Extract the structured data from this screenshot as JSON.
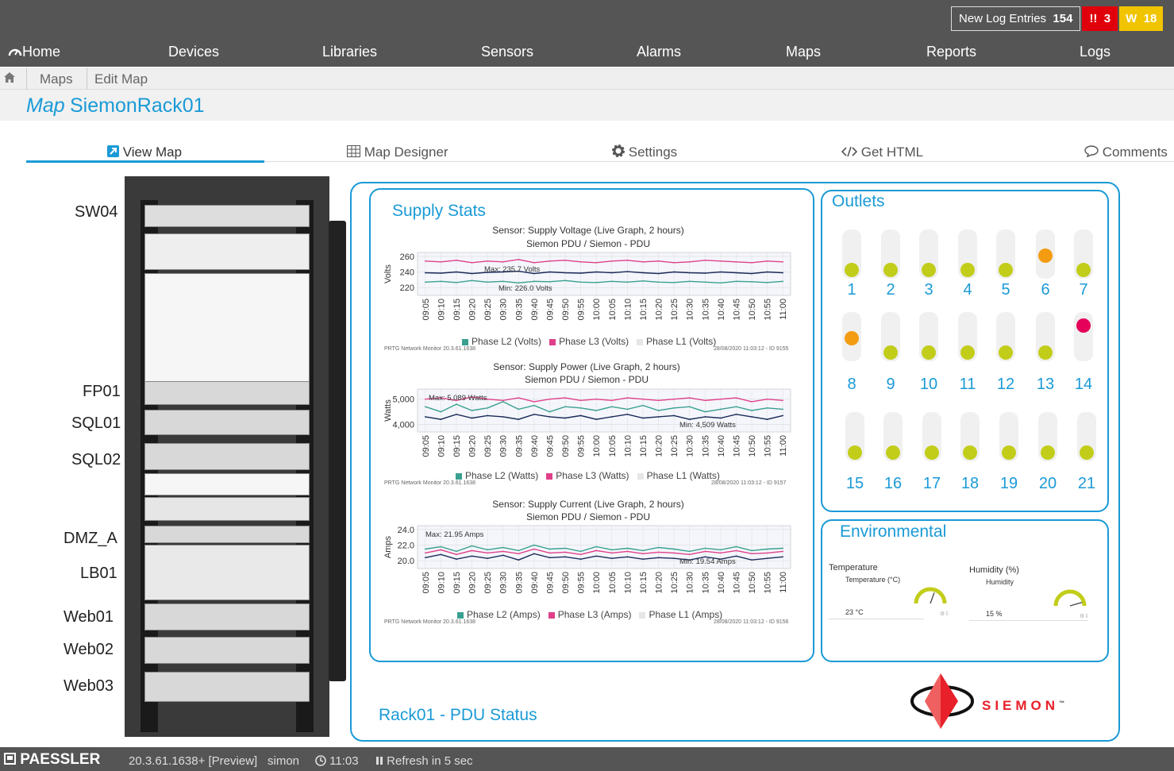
{
  "topbar": {
    "log_label": "New Log Entries",
    "log_count": "154",
    "errors": "3",
    "warnings": "18",
    "errors_icon": "!!",
    "warnings_icon": "W"
  },
  "nav": [
    "Home",
    "Devices",
    "Libraries",
    "Sensors",
    "Alarms",
    "Maps",
    "Reports",
    "Logs"
  ],
  "breadcrumb": [
    "Maps",
    "Edit Map"
  ],
  "title": {
    "prefix": "Map",
    "name": "SiemonRack01"
  },
  "tabs": [
    "View Map",
    "Map Designer",
    "Settings",
    "Get HTML",
    "Comments"
  ],
  "rack": {
    "labels": [
      "SW04",
      "FP01",
      "SQL01",
      "SQL02",
      "DMZ_A",
      "LB01",
      "Web01",
      "Web02",
      "Web03"
    ]
  },
  "supply": {
    "title": "Supply Stats",
    "footer_title": "Rack01 - PDU Status",
    "footer_left": "PRTG Network Monitor 20.3.61.1638"
  },
  "chart_data": [
    {
      "type": "line",
      "title": "Sensor: Supply Voltage (Live Graph, 2 hours)",
      "subtitle": "Siemon PDU / Siemon - PDU",
      "ylabel": "Volts",
      "ylim": [
        210,
        265
      ],
      "yticks": [
        "260",
        "240",
        "220"
      ],
      "ytick_values": [
        260,
        240,
        220
      ],
      "x": [
        "09:05",
        "09:10",
        "09:15",
        "09:20",
        "09:25",
        "09:30",
        "09:35",
        "09:40",
        "09:45",
        "09:50",
        "09:55",
        "10:00",
        "10:05",
        "10:10",
        "10:15",
        "10:20",
        "10:25",
        "10:30",
        "10:35",
        "10:40",
        "10:45",
        "10:50",
        "10:55",
        "11:00"
      ],
      "series": [
        {
          "name": "Phase L2  (Volts)",
          "color": "#1a2a5a",
          "values": [
            239,
            238.5,
            240,
            238,
            239.5,
            240,
            241,
            238,
            240,
            239,
            238.5,
            240,
            239,
            240.5,
            239,
            238,
            240,
            239,
            238.5,
            240,
            239,
            238,
            240,
            239
          ]
        },
        {
          "name": "Phase L3  (Volts)",
          "color": "#e0408a",
          "values": [
            254,
            253,
            255,
            252,
            254,
            253,
            256,
            252,
            254,
            255,
            253,
            252,
            254,
            255,
            253,
            254,
            252,
            253,
            255,
            254,
            253,
            252,
            254,
            253
          ]
        },
        {
          "name": "Phase L1  (Volts)",
          "color": "#3aa090",
          "values": [
            227,
            228,
            226.5,
            229,
            227,
            228,
            226,
            228,
            227.5,
            229,
            227,
            226.5,
            228,
            227,
            228.5,
            227,
            226.5,
            228,
            227,
            226,
            228,
            227.5,
            226.5,
            228
          ]
        }
      ],
      "annotations": [
        "Max: 235.7 Volts",
        "Min: 226.0 Volts"
      ],
      "footer_right": "28/08/2020 11:03:12 - ID 9155"
    },
    {
      "type": "line",
      "title": "Sensor: Supply Power (Live Graph, 2 hours)",
      "subtitle": "Siemon PDU / Siemon - PDU",
      "ylabel": "Watts",
      "ylim": [
        3700,
        5400
      ],
      "yticks": [
        "5,000",
        "4,000"
      ],
      "ytick_values": [
        5000,
        4000
      ],
      "x": [
        "09:05",
        "09:10",
        "09:15",
        "09:20",
        "09:25",
        "09:30",
        "09:35",
        "09:40",
        "09:45",
        "09:50",
        "09:55",
        "10:00",
        "10:05",
        "10:10",
        "10:15",
        "10:20",
        "10:25",
        "10:30",
        "10:35",
        "10:40",
        "10:45",
        "10:50",
        "10:55",
        "11:00"
      ],
      "series": [
        {
          "name": "Phase L2  (Watts)",
          "color": "#3aa090",
          "values": [
            4700,
            4500,
            4800,
            4550,
            4650,
            4900,
            4600,
            4750,
            4500,
            4700,
            4650,
            4550,
            4700,
            4600,
            4750,
            4550,
            4650,
            4700,
            4500,
            4600,
            4700,
            4550,
            4650,
            4600
          ]
        },
        {
          "name": "Phase L3  (Watts)",
          "color": "#e0408a",
          "values": [
            5000,
            5050,
            4950,
            5089,
            5000,
            4950,
            5050,
            4900,
            5000,
            5050,
            4950,
            5000,
            4950,
            5050,
            5000,
            4950,
            5000,
            5050,
            4950,
            5000,
            5050,
            4900,
            5000,
            4950
          ]
        },
        {
          "name": "Phase L1  (Watts)",
          "color": "#1a2a5a",
          "values": [
            4300,
            4200,
            4400,
            4250,
            4350,
            4300,
            4200,
            4400,
            4300,
            4250,
            4350,
            4200,
            4300,
            4400,
            4250,
            4300,
            4350,
            4200,
            4300,
            4250,
            4400,
            4300,
            4200,
            4350
          ]
        }
      ],
      "annotations": [
        "Max: 5,089 Watts",
        "Min: 4,509 Watts"
      ],
      "footer_right": "28/08/2020 11:03:12 - ID 9157"
    },
    {
      "type": "line",
      "title": "Sensor: Supply Current (Live Graph, 2 hours)",
      "subtitle": "Siemon PDU / Siemon - PDU",
      "ylabel": "Amps",
      "ylim": [
        19.0,
        24.5
      ],
      "yticks": [
        "24.0",
        "22.0",
        "20.0"
      ],
      "ytick_values": [
        24,
        22,
        20
      ],
      "x": [
        "09:05",
        "09:10",
        "09:15",
        "09:20",
        "09:25",
        "09:30",
        "09:35",
        "09:40",
        "09:45",
        "09:50",
        "09:55",
        "10:00",
        "10:05",
        "10:10",
        "10:15",
        "10:20",
        "10:25",
        "10:30",
        "10:35",
        "10:40",
        "10:45",
        "10:50",
        "10:55",
        "11:00"
      ],
      "series": [
        {
          "name": "Phase L2  (Amps)",
          "color": "#3aa090",
          "values": [
            21.5,
            21.8,
            21.2,
            21.9,
            21.4,
            21.7,
            21.3,
            22.0,
            21.5,
            21.6,
            21.2,
            21.8,
            21.4,
            21.6,
            21.3,
            21.7,
            21.5,
            21.2,
            21.6,
            21.4,
            21.8,
            21.3,
            21.5,
            21.6
          ]
        },
        {
          "name": "Phase L3  (Amps)",
          "color": "#e0408a",
          "values": [
            21.0,
            21.4,
            20.8,
            21.3,
            21.0,
            21.2,
            20.9,
            21.5,
            21.0,
            21.1,
            20.8,
            21.3,
            21.0,
            21.2,
            20.9,
            21.1,
            21.0,
            20.8,
            21.2,
            21.0,
            21.3,
            20.9,
            21.0,
            21.2
          ]
        },
        {
          "name": "Phase L1  (Amps)",
          "color": "#1a2a5a",
          "values": [
            20.4,
            20.8,
            20.2,
            20.6,
            20.3,
            20.7,
            20.1,
            20.9,
            20.4,
            20.5,
            20.2,
            20.6,
            20.3,
            20.5,
            20.2,
            20.4,
            20.3,
            20.1,
            20.5,
            20.2,
            20.6,
            20.1,
            20.3,
            20.5
          ]
        }
      ],
      "annotations": [
        "Max: 21.95 Amps",
        "Min: 19.54 Amps"
      ],
      "footer_right": "28/08/2020 11:03:12 - ID 9156"
    }
  ],
  "outlets": {
    "title": "Outlets",
    "items": [
      {
        "n": "1",
        "state": "green"
      },
      {
        "n": "2",
        "state": "green"
      },
      {
        "n": "3",
        "state": "green"
      },
      {
        "n": "4",
        "state": "green"
      },
      {
        "n": "5",
        "state": "green"
      },
      {
        "n": "6",
        "state": "orange"
      },
      {
        "n": "7",
        "state": "green"
      },
      {
        "n": "8",
        "state": "orange"
      },
      {
        "n": "9",
        "state": "green"
      },
      {
        "n": "10",
        "state": "green"
      },
      {
        "n": "11",
        "state": "green"
      },
      {
        "n": "12",
        "state": "green"
      },
      {
        "n": "13",
        "state": "green"
      },
      {
        "n": "14",
        "state": "red"
      },
      {
        "n": "15",
        "state": "green"
      },
      {
        "n": "16",
        "state": "green"
      },
      {
        "n": "17",
        "state": "green"
      },
      {
        "n": "18",
        "state": "green"
      },
      {
        "n": "19",
        "state": "green"
      },
      {
        "n": "20",
        "state": "green"
      },
      {
        "n": "21",
        "state": "green"
      }
    ],
    "colors": {
      "green": "#c2cd1a",
      "orange": "#f39c12",
      "red": "#e5005a"
    }
  },
  "environmental": {
    "title": "Environmental",
    "temp_label": "Temperature",
    "temp_sub": "Temperature (°C)",
    "temp_value": "23 °C",
    "temp_level": 0.38,
    "hum_label": "Humidity (%)",
    "hum_sub": "Humidity",
    "hum_value": "15 %",
    "hum_level": 0.15
  },
  "logo": {
    "text": "SIEMON",
    "tm": "™"
  },
  "status": {
    "brand": "PAESSLER",
    "version": "20.3.61.1638+ [Preview]",
    "user": "simon",
    "time": "11:03",
    "refresh": "Refresh in 5 sec"
  }
}
